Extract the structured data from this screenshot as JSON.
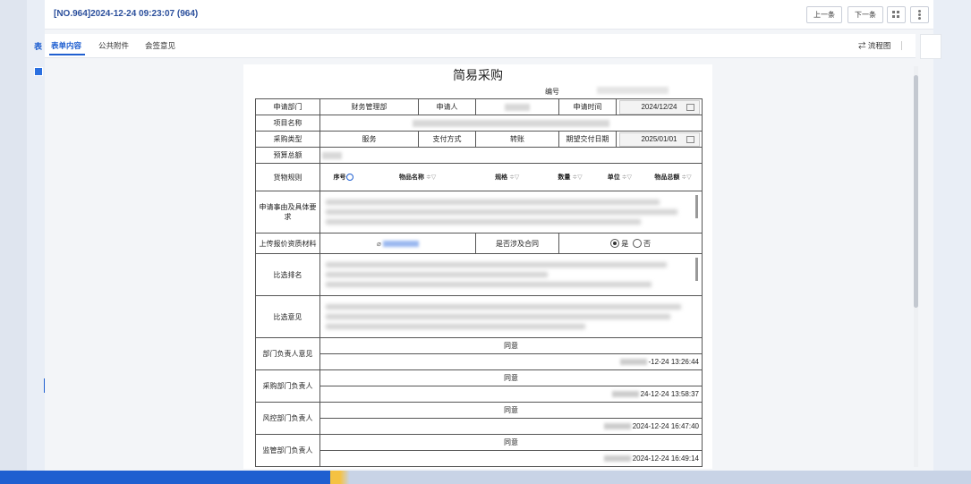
{
  "window": {
    "title": "[NO.964]2024-12-24 09:23:07 (964)",
    "prev_label": "上一条",
    "next_label": "下一条"
  },
  "left": {
    "tab_fragment": "表"
  },
  "tabs": [
    {
      "label": "表单内容",
      "active": true
    },
    {
      "label": "公共附件",
      "active": false
    },
    {
      "label": "会签意见",
      "active": false
    }
  ],
  "flow_label": "流程图",
  "form": {
    "title": "简易采购",
    "number_label": "编号",
    "dept_label": "申请部门",
    "dept_value": "财务管理部",
    "applicant_label": "申请人",
    "apply_time_label": "申请时间",
    "apply_time_value": "2024/12/24",
    "project_label": "项目名称",
    "purchase_type_label": "采购类型",
    "purchase_type_value": "服务",
    "pay_method_label": "支付方式",
    "pay_method_value": "转账",
    "delivery_label": "期望交付日期",
    "delivery_value": "2025/01/01",
    "budget_label": "预算总额",
    "goods_label": "货物规则",
    "goods_columns": [
      "序号",
      "物品名称",
      "规格",
      "数量",
      "单位",
      "物品总额"
    ],
    "reason_label": "申请事由及具体要求",
    "upload_label": "上传报价资质材料",
    "contract_label": "是否涉及合同",
    "contract_yes": "是",
    "contract_no": "否",
    "rank_label": "比选排名",
    "opinion_label": "比选意见",
    "approvals": [
      {
        "label": "部门负责人意见",
        "opinion": "同意",
        "time": "-12-24 13:26:44"
      },
      {
        "label": "采购部门负责人",
        "opinion": "同意",
        "time": "24-12-24 13:58:37"
      },
      {
        "label": "风控部门负责人",
        "opinion": "同意",
        "time": "2024-12-24 16:47:40"
      },
      {
        "label": "监管部门负责人",
        "opinion": "同意",
        "time": "2024-12-24 16:49:14"
      }
    ]
  }
}
